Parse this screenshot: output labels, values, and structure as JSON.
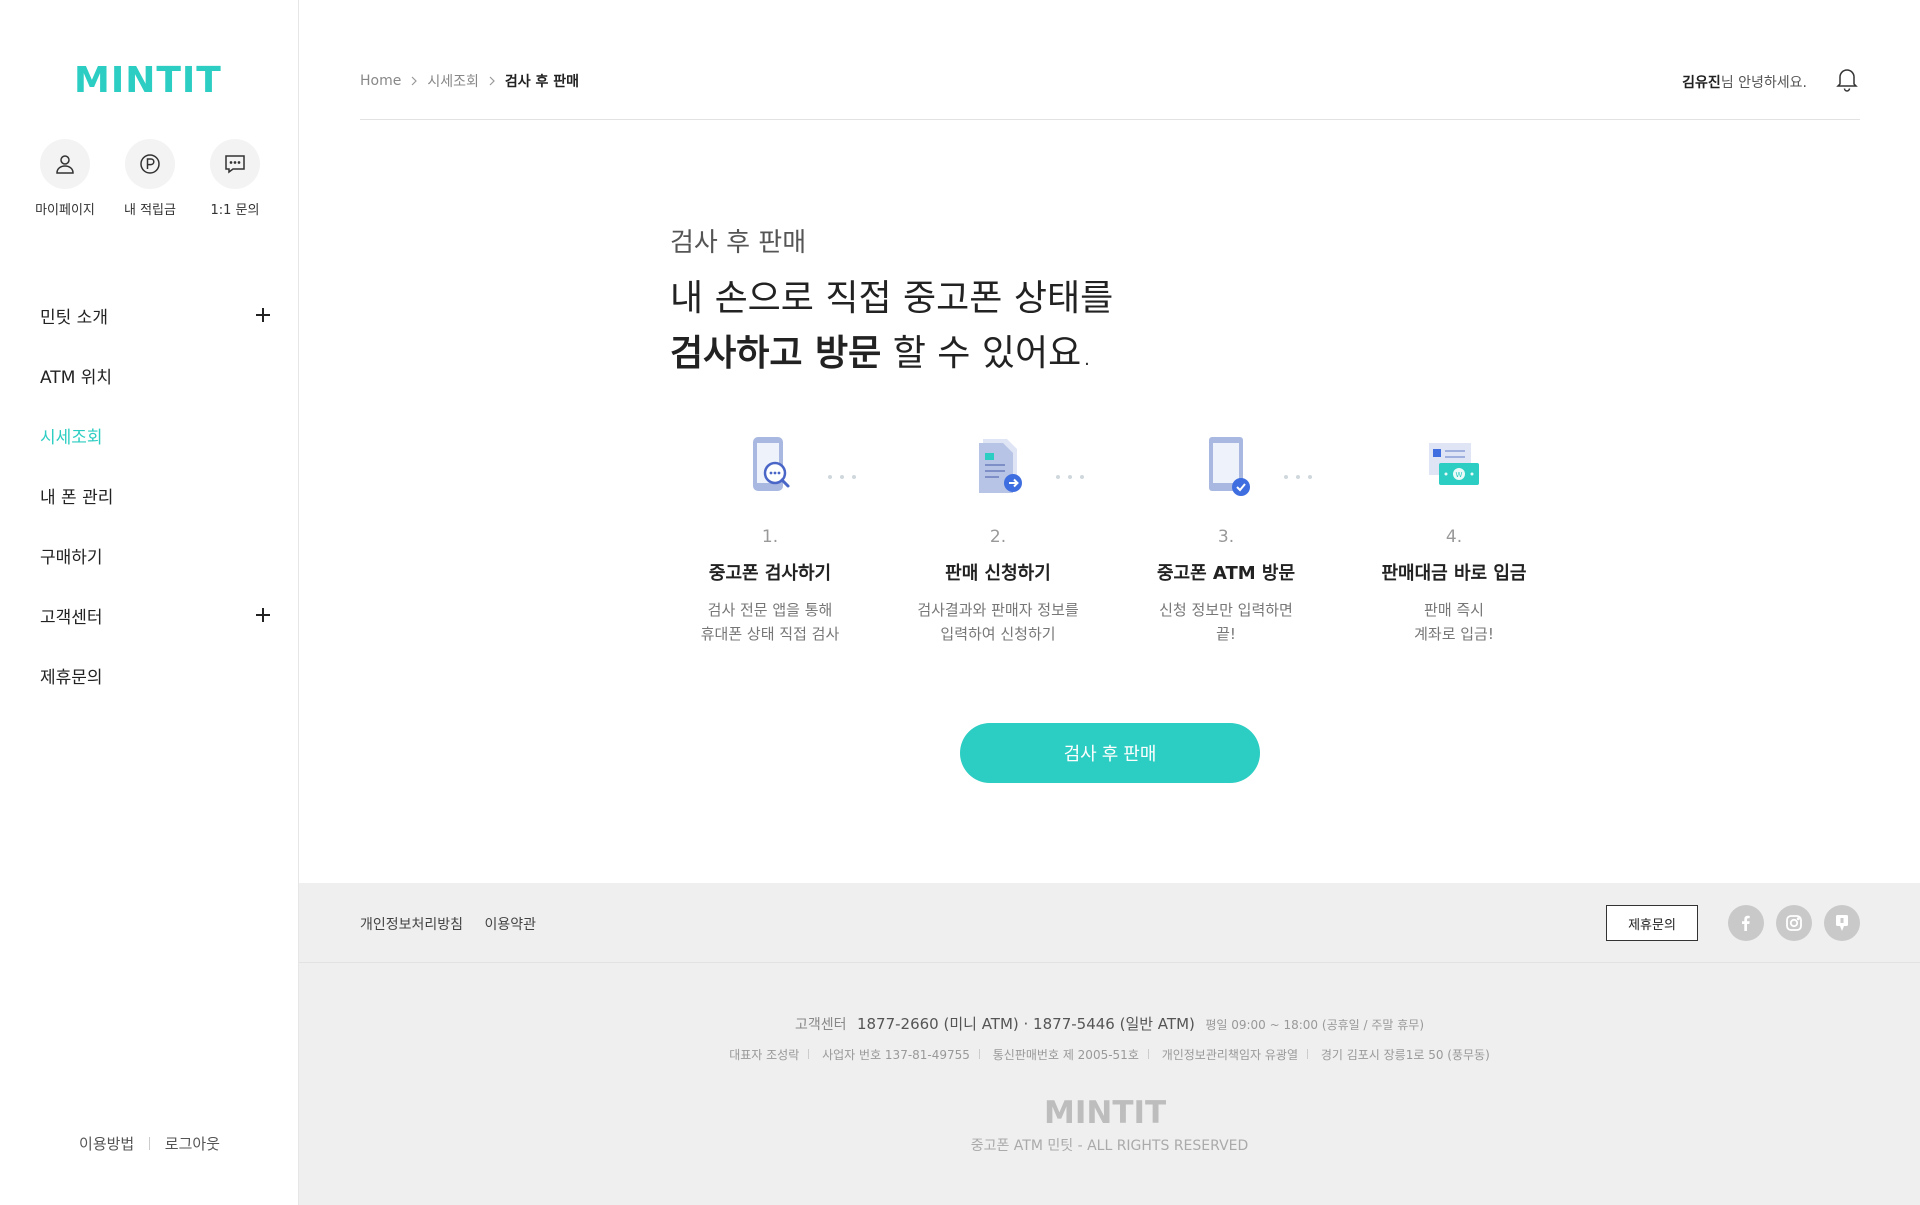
{
  "brand": {
    "name": "MINTIT",
    "accent_color": "#2ccdc2"
  },
  "sidebar": {
    "quick_links": [
      {
        "label": "마이페이지",
        "icon": "user-icon"
      },
      {
        "label": "내 적립금",
        "icon": "point-icon"
      },
      {
        "label": "1:1 문의",
        "icon": "chat-icon"
      }
    ],
    "menu": [
      {
        "label": "민팃 소개",
        "expandable": true,
        "active": false
      },
      {
        "label": "ATM 위치",
        "expandable": false,
        "active": false
      },
      {
        "label": "시세조회",
        "expandable": false,
        "active": true
      },
      {
        "label": "내 폰 관리",
        "expandable": false,
        "active": false
      },
      {
        "label": "구매하기",
        "expandable": false,
        "active": false
      },
      {
        "label": "고객센터",
        "expandable": true,
        "active": false
      },
      {
        "label": "제휴문의",
        "expandable": false,
        "active": false
      }
    ],
    "bottom": {
      "guide": "이용방법",
      "logout": "로그아웃"
    }
  },
  "header": {
    "breadcrumb": [
      "Home",
      "시세조회",
      "검사 후 판매"
    ],
    "user_name": "김유진",
    "greeting_suffix": "님 안녕하세요."
  },
  "main": {
    "section_label": "검사 후 판매",
    "headline_line1": "내 손으로 직접 중고폰 상태를",
    "headline_bold": "검사하고 방문",
    "headline_rest": " 할 수 있어요.",
    "steps": [
      {
        "num": "1.",
        "title": "중고폰 검사하기",
        "desc1": "검사 전문 앱을 통해",
        "desc2": "휴대폰 상태 직접 검사",
        "icon": "phone-search-icon"
      },
      {
        "num": "2.",
        "title": "판매 신청하기",
        "desc1": "검사결과와 판매자 정보를",
        "desc2": "입력하여 신청하기",
        "icon": "document-arrow-icon"
      },
      {
        "num": "3.",
        "title": "중고폰 ATM 방문",
        "desc1": "신청 정보만 입력하면",
        "desc2": "끝!",
        "icon": "phone-check-icon"
      },
      {
        "num": "4.",
        "title": "판매대금 바로 입금",
        "desc1": "판매 즉시",
        "desc2": "계좌로 입금!",
        "icon": "money-icon"
      }
    ],
    "cta_label": "검사 후 판매"
  },
  "footer": {
    "links": [
      "개인정보처리방침",
      "이용약관"
    ],
    "partner_button": "제휴문의",
    "social": [
      "facebook-icon",
      "instagram-icon",
      "blog-icon"
    ],
    "cs_label": "고객센터",
    "cs_phone": "1877-2660 (미니 ATM) · 1877-5446 (일반 ATM)",
    "cs_hours": "평일 09:00 ~ 18:00 (공휴일 / 주말 휴무)",
    "biz": [
      "대표자  조성락",
      "사업자 번호  137-81-49755",
      "통신판매번호 제 2005-51호",
      "개인정보관리책임자  유광열",
      "경기 김포시 장릉1로 50 (풍무동)"
    ],
    "copyright": "중고폰 ATM 민팃 - ALL RIGHTS RESERVED"
  }
}
